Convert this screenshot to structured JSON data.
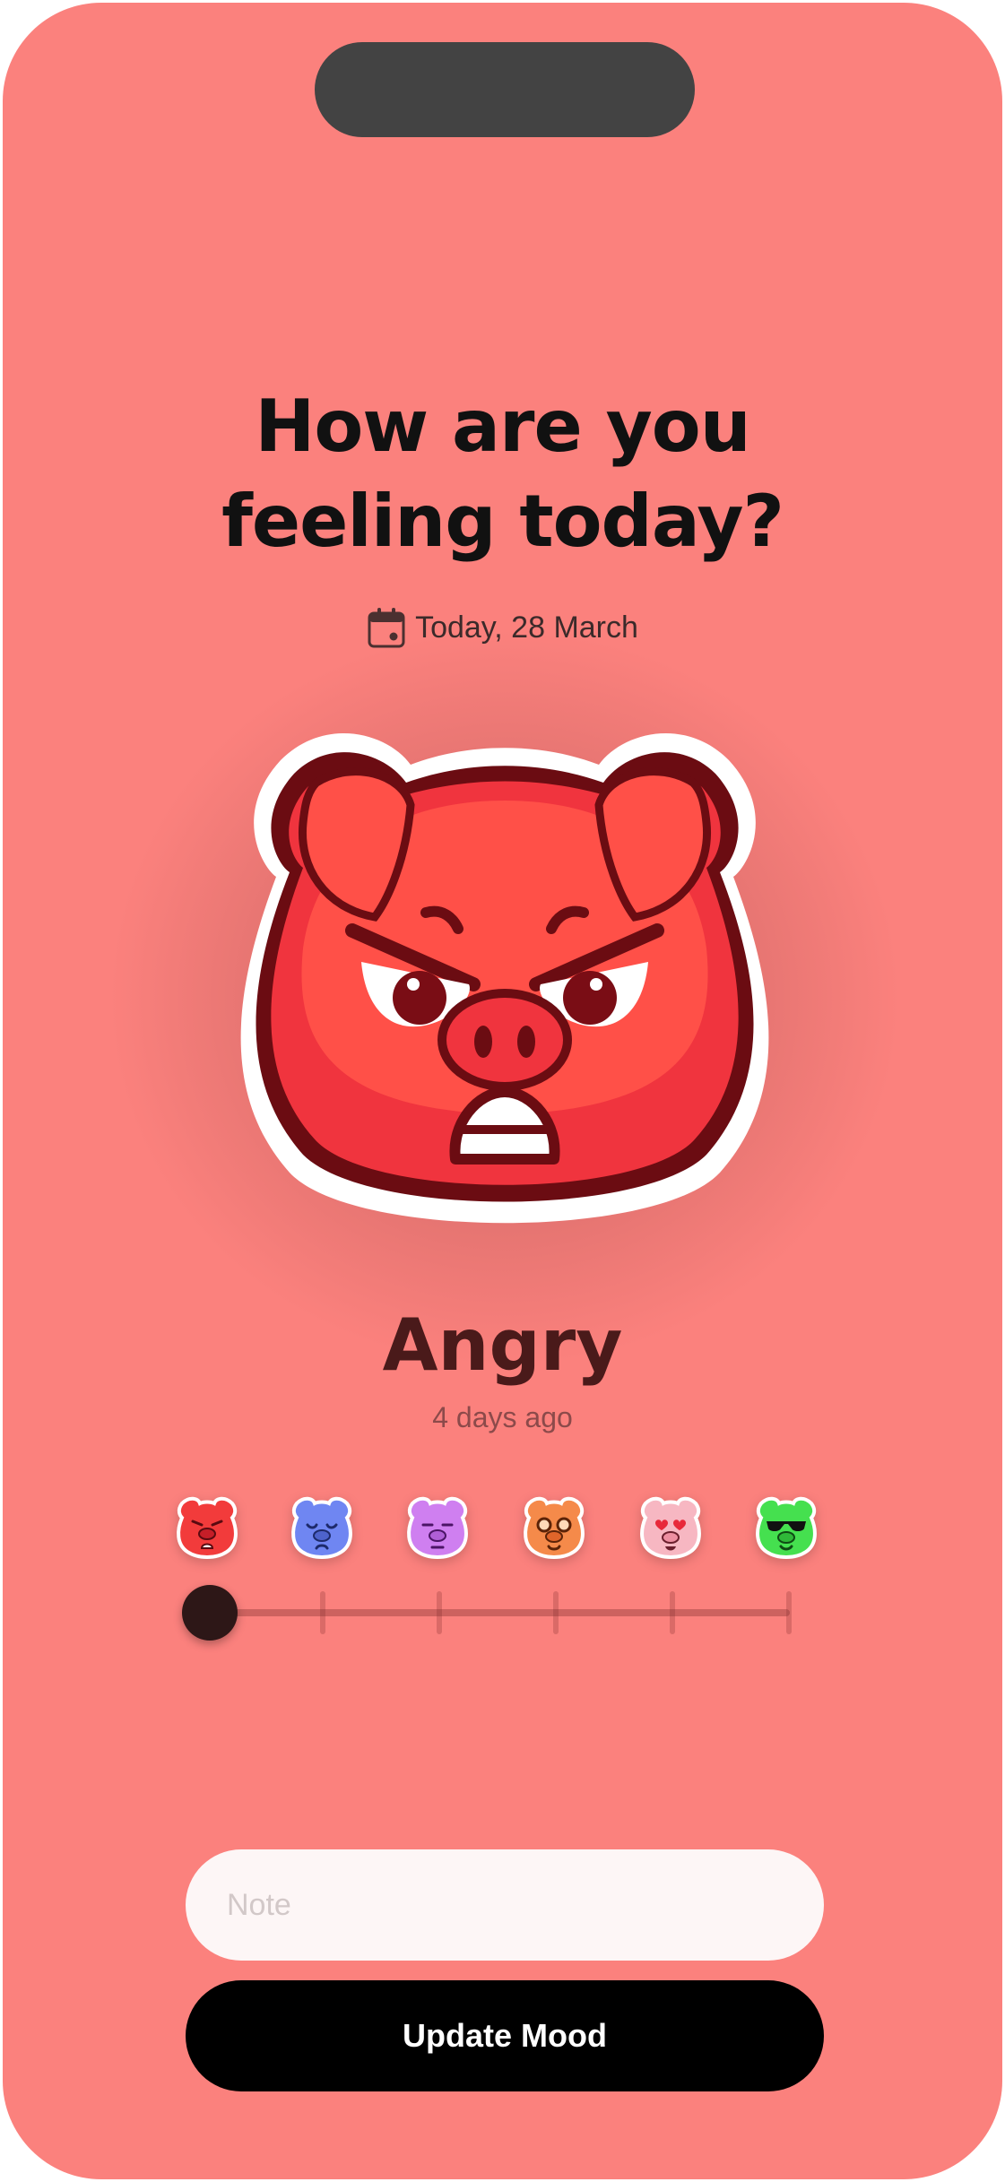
{
  "title": {
    "line1": "How are you",
    "line2": "feeling today?"
  },
  "date": {
    "icon": "calendar-icon",
    "label": "Today, 28 March"
  },
  "current_mood": {
    "name": "Angry",
    "time_ago": "4 days ago",
    "icon": "angry-pig-icon"
  },
  "moods": [
    {
      "icon": "angry-pig-icon",
      "color": "#f23b3b"
    },
    {
      "icon": "sad-pig-icon",
      "color": "#6f86f2"
    },
    {
      "icon": "meh-pig-icon",
      "color": "#cf7ff0"
    },
    {
      "icon": "nerd-pig-icon",
      "color": "#f58a4a"
    },
    {
      "icon": "love-pig-icon",
      "color": "#f7b7c2"
    },
    {
      "icon": "cool-pig-icon",
      "color": "#45e04f"
    }
  ],
  "slider": {
    "selected_index": 0,
    "steps": 6
  },
  "note": {
    "placeholder": "Note",
    "value": ""
  },
  "update_button": {
    "label": "Update Mood"
  },
  "colors": {
    "background": "#fb817d",
    "button": "#000000",
    "thumb": "#2d1717"
  }
}
